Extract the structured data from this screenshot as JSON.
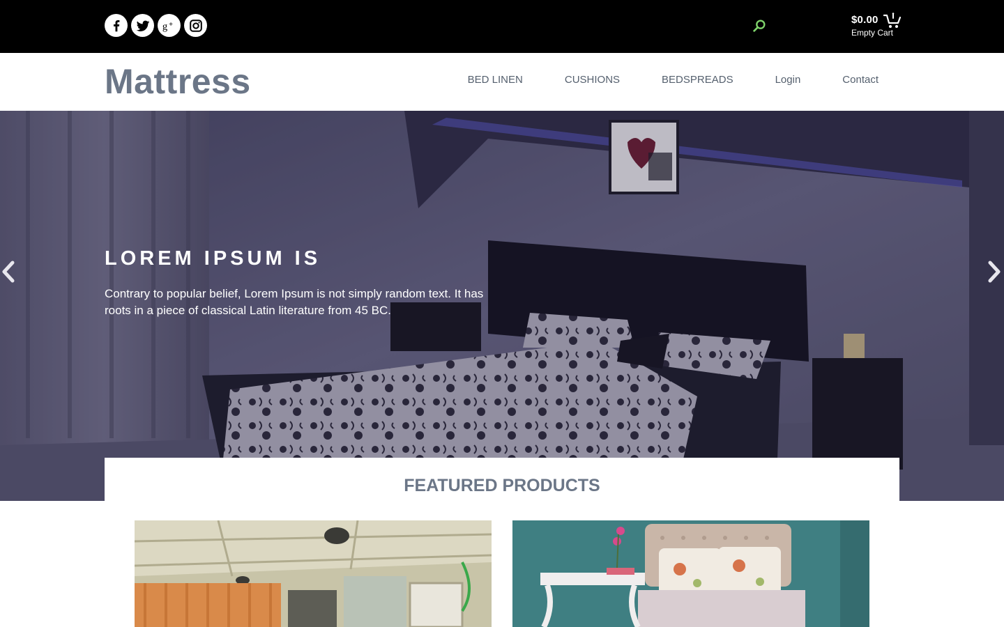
{
  "social": {
    "items": [
      {
        "name": "facebook",
        "icon": "facebook-icon"
      },
      {
        "name": "twitter",
        "icon": "twitter-icon"
      },
      {
        "name": "google-plus",
        "icon": "google-plus-icon"
      },
      {
        "name": "instagram",
        "icon": "instagram-icon"
      }
    ]
  },
  "search": {
    "icon": "search-icon",
    "color": "#7fd36b"
  },
  "cart": {
    "amount": "$0.00",
    "status": "Empty Cart",
    "icon": "cart-icon"
  },
  "header": {
    "logo": "Mattress",
    "nav": [
      "BED LINEN",
      "CUSHIONS",
      "BEDSPREADS",
      "Login",
      "Contact"
    ]
  },
  "hero": {
    "title": "LOREM IPSUM IS",
    "text": "Contrary to popular belief, Lorem Ipsum is not simply random text. It has roots in a piece of classical Latin literature from 45 BC.",
    "prev_icon": "chevron-left-icon",
    "next_icon": "chevron-right-icon"
  },
  "featured": {
    "title": "FEATURED PRODUCTS"
  },
  "colors": {
    "topbar": "#000000",
    "logo": "#6b7687",
    "nav": "#55606e",
    "accent": "#7fd36b"
  }
}
